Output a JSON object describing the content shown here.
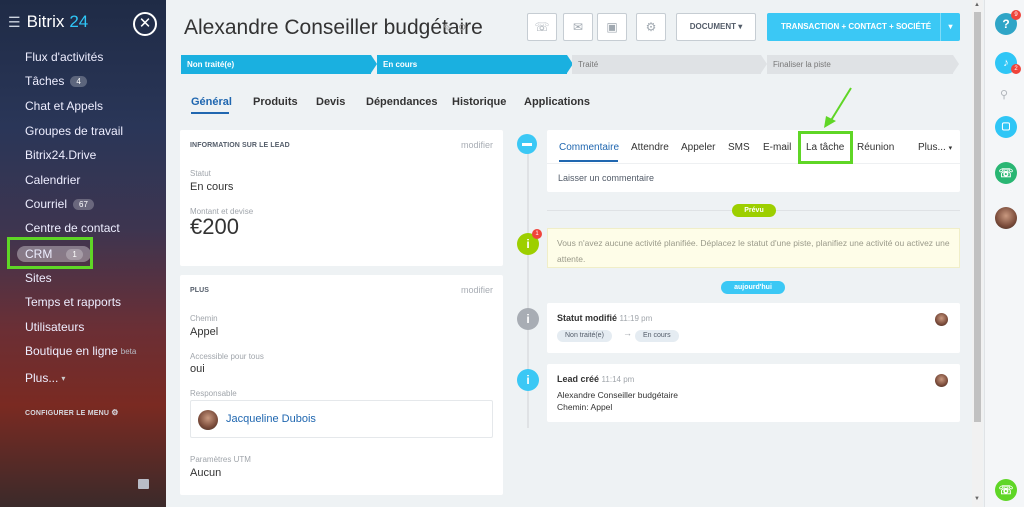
{
  "sidebar": {
    "brand_main": "Bitrix",
    "brand_num": "24",
    "close_glyph": "✕",
    "items": [
      {
        "label": "Flux d'activités"
      },
      {
        "label": "Tâches",
        "badge": "4"
      },
      {
        "label": "Chat et Appels"
      },
      {
        "label": "Groupes de travail"
      },
      {
        "label": "Bitrix24.Drive"
      },
      {
        "label": "Calendrier"
      },
      {
        "label": "Courriel",
        "badge": "67"
      },
      {
        "label": "Centre de contact"
      },
      {
        "label": "CRM",
        "badge": "1"
      },
      {
        "label": "Sites"
      },
      {
        "label": "Temps et rapports"
      },
      {
        "label": "Utilisateurs"
      },
      {
        "label": "Boutique en ligne",
        "beta": "beta"
      },
      {
        "label": "Plus..."
      }
    ],
    "configure": "CONFIGURER LE MENU"
  },
  "header": {
    "title": "Alexandre Conseiller budgétaire",
    "document_btn": "DOCUMENT",
    "deal_btn": "TRANSACTION + CONTACT + SOCIÉTÉ"
  },
  "stages": [
    {
      "label": "Non traité(e)",
      "state": "active"
    },
    {
      "label": "En cours",
      "state": "active"
    },
    {
      "label": "Traité",
      "state": "inactive"
    },
    {
      "label": "Finaliser la piste",
      "state": "inactive"
    }
  ],
  "tabs": [
    "Général",
    "Produits",
    "Devis",
    "Dépendances",
    "Historique",
    "Applications"
  ],
  "lead_card": {
    "heading": "INFORMATION SUR LE LEAD",
    "modify": "modifier",
    "status_label": "Statut",
    "status_value": "En cours",
    "amount_label": "Montant et devise",
    "amount_currency": "€",
    "amount_value": "200"
  },
  "plus_card": {
    "heading": "PLUS",
    "modify": "modifier",
    "path_label": "Chemin",
    "path_value": "Appel",
    "public_label": "Accessible pour tous",
    "public_value": "oui",
    "responsible_label": "Responsable",
    "responsible_name": "Jacqueline Dubois",
    "utm_label": "Paramètres UTM",
    "utm_value": "Aucun"
  },
  "activity_tabs": [
    "Commentaire",
    "Attendre",
    "Appeler",
    "SMS",
    "E-mail",
    "La tâche",
    "Réunion",
    "Plus..."
  ],
  "comment_placeholder": "Laisser un commentaire",
  "timeline": {
    "planned_pill": "Prévu",
    "empty_text": "Vous n'avez aucune activité planifiée. Déplacez le statut d'une piste, planifiez une activité ou activez une attente.",
    "empty_badge": "1",
    "today_pill": "aujourd'hui",
    "status_changed_title": "Statut modifié",
    "status_changed_time": "11:19 pm",
    "from_stage": "Non traité(e)",
    "arrow": "→",
    "to_stage": "En cours",
    "lead_created_title": "Lead créé",
    "lead_created_time": "11:14 pm",
    "lead_created_line1": "Alexandre Conseiller budgétaire",
    "lead_created_line2": "Chemin: Appel"
  },
  "rightbar": {
    "help_badge": "9",
    "notif_badge": "2"
  },
  "colors": {
    "accent": "#3bc8f5",
    "stage_active": "#1ab0e0",
    "highlight": "#5fd626",
    "link": "#2067b0"
  }
}
